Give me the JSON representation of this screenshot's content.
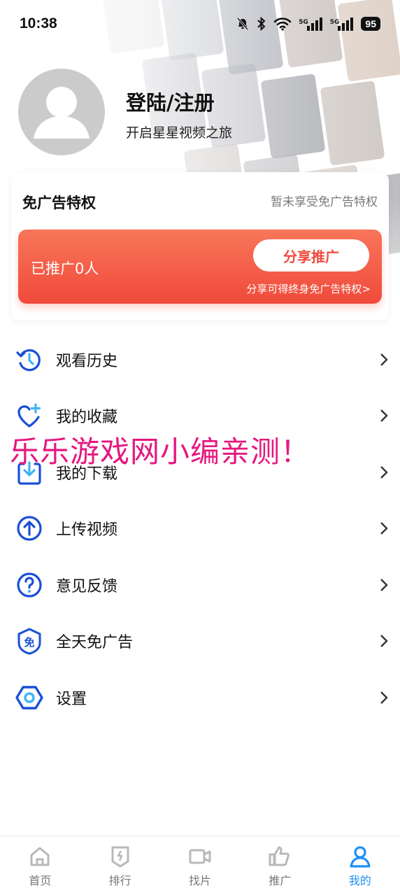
{
  "status_bar": {
    "time": "10:38",
    "network_badge_1": "5G",
    "network_badge_2": "5G",
    "battery": "95"
  },
  "profile": {
    "title": "登陆/注册",
    "subtitle": "开启星星视频之旅"
  },
  "ad_free_card": {
    "title": "免广告特权",
    "status": "暂未享受免广告特权",
    "promoted_count": "已推广0人",
    "share_button": "分享推广",
    "share_hint": "分享可得终身免广告特权>"
  },
  "menu": [
    {
      "label": "观看历史",
      "icon": "history-icon"
    },
    {
      "label": "我的收藏",
      "icon": "heart-add-icon"
    },
    {
      "label": "我的下载",
      "icon": "download-icon"
    },
    {
      "label": "上传视频",
      "icon": "upload-icon"
    },
    {
      "label": "意见反馈",
      "icon": "question-icon"
    },
    {
      "label": "全天免广告",
      "icon": "ad-free-icon"
    },
    {
      "label": "设置",
      "icon": "settings-icon"
    }
  ],
  "watermark": "乐乐游戏网小编亲测！",
  "tabs": [
    {
      "label": "首页",
      "icon": "home-icon",
      "active": false
    },
    {
      "label": "排行",
      "icon": "ranking-icon",
      "active": false
    },
    {
      "label": "找片",
      "icon": "video-camera-icon",
      "active": false
    },
    {
      "label": "推广",
      "icon": "thumbs-up-icon",
      "active": false
    },
    {
      "label": "我的",
      "icon": "profile-icon",
      "active": true
    }
  ],
  "colors": {
    "accent_blue": "#1f8ff2",
    "icon_blue": "#1a4fd6",
    "promo_red": "#f04a3b",
    "watermark_pink": "#e5187f"
  }
}
